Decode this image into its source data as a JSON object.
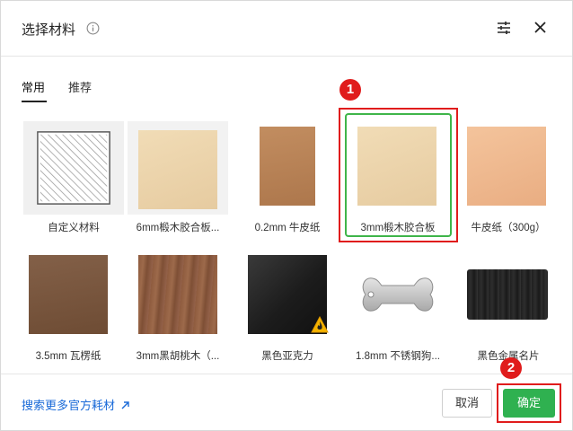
{
  "header": {
    "title": "选择材料",
    "info_icon": "info-circle-icon",
    "settings_icon": "sliders-icon",
    "close_icon": "close-icon"
  },
  "tabs": [
    {
      "label": "常用",
      "active": true
    },
    {
      "label": "推荐",
      "active": false
    }
  ],
  "materials": [
    {
      "label": "自定义材料",
      "kind": "custom",
      "color": "#f2f2f2"
    },
    {
      "label": "6mm椴木胶合板...",
      "kind": "wood",
      "color": "#ecd5ad"
    },
    {
      "label": "0.2mm 牛皮纸",
      "kind": "kraft",
      "color": "#b88257"
    },
    {
      "label": "3mm椴木胶合板",
      "kind": "wood",
      "color": "#ecd5ad",
      "selected": true
    },
    {
      "label": "牛皮纸（300g）",
      "kind": "kraft-light",
      "color": "#eeb88d"
    },
    {
      "label": "3.5mm 瓦楞纸",
      "kind": "cardboard",
      "color": "#7b563c"
    },
    {
      "label": "3mm黑胡桃木（...",
      "kind": "walnut",
      "color": "#8c5a3d"
    },
    {
      "label": "黑色亚克力",
      "kind": "acrylic",
      "color": "#1e1e1e",
      "warning": true
    },
    {
      "label": "1.8mm 不锈钢狗...",
      "kind": "steel-tag",
      "color": "#c7c7c7"
    },
    {
      "label": "黑色金属名片",
      "kind": "metal-card",
      "color": "#2a2a2a"
    }
  ],
  "annotations": {
    "badge_1": "1",
    "badge_2": "2"
  },
  "footer": {
    "link": "搜索更多官方耗材",
    "link_icon": "external-arrow-icon",
    "cancel": "取消",
    "confirm": "确定"
  },
  "colors": {
    "accent_green": "#2fb150",
    "selected_border": "#3fb54a",
    "annotation_red": "#e01c1c",
    "link_blue": "#1a6ad8"
  }
}
